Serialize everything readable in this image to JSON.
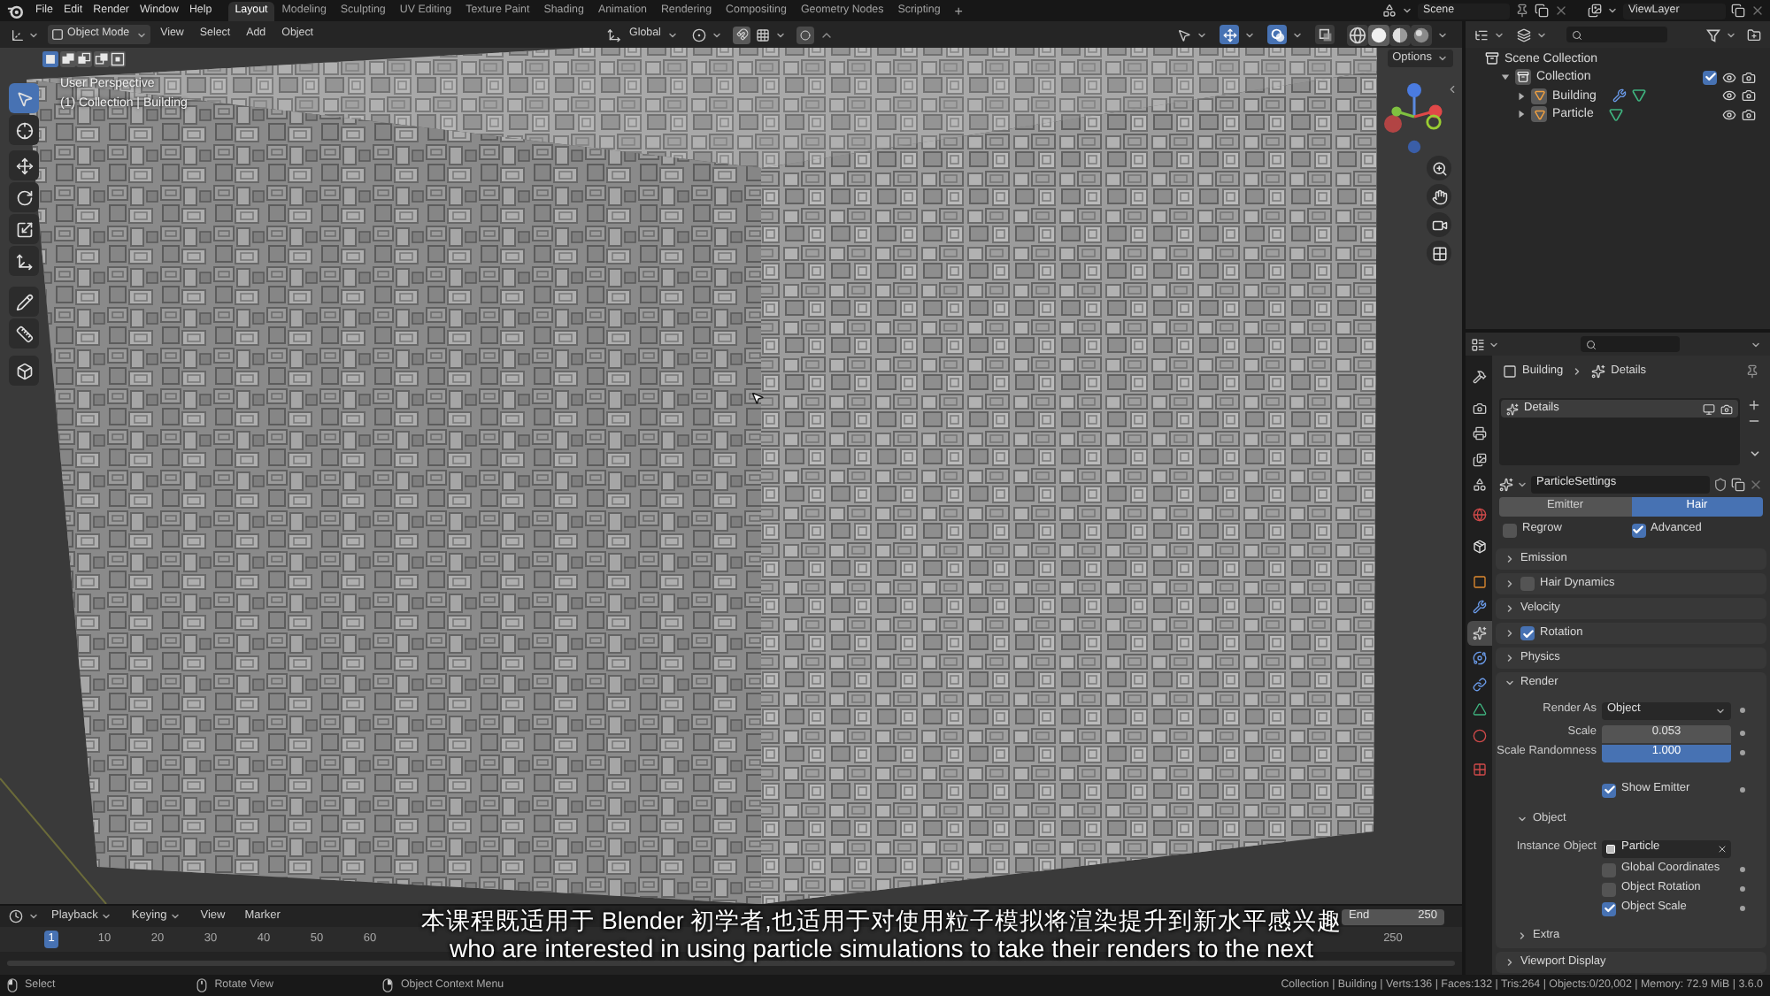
{
  "top_bar": {
    "menus": [
      "File",
      "Edit",
      "Render",
      "Window",
      "Help"
    ],
    "workspaces": [
      {
        "label": "Layout",
        "selected": true
      },
      {
        "label": "Modeling",
        "selected": false
      },
      {
        "label": "Sculpting",
        "selected": false
      },
      {
        "label": "UV Editing",
        "selected": false
      },
      {
        "label": "Texture Paint",
        "selected": false
      },
      {
        "label": "Shading",
        "selected": false
      },
      {
        "label": "Animation",
        "selected": false
      },
      {
        "label": "Rendering",
        "selected": false
      },
      {
        "label": "Compositing",
        "selected": false
      },
      {
        "label": "Geometry Nodes",
        "selected": false
      },
      {
        "label": "Scripting",
        "selected": false
      }
    ],
    "add_workspace": "+",
    "scene": "Scene",
    "view_layer": "ViewLayer"
  },
  "viewport": {
    "mode": "Object Mode",
    "menus": [
      "View",
      "Select",
      "Add",
      "Object"
    ],
    "orientation": "Global",
    "toggles": [
      {
        "kind": "gizmos",
        "on": true
      },
      {
        "kind": "overlays",
        "on": true
      },
      {
        "kind": "xray",
        "on": false
      }
    ],
    "shading": [
      {
        "kind": "wireframe",
        "selected": false
      },
      {
        "kind": "solid",
        "selected": true
      },
      {
        "kind": "material",
        "selected": false
      },
      {
        "kind": "rendered",
        "selected": false
      }
    ],
    "select_modes": [
      {
        "kind": "new",
        "selected": true
      },
      {
        "kind": "extend",
        "selected": false
      },
      {
        "kind": "subtract",
        "selected": false
      },
      {
        "kind": "invert",
        "selected": false
      },
      {
        "kind": "intersect",
        "selected": false
      }
    ],
    "options": "Options",
    "view_name": "User Perspective",
    "context": "(1) Collection | Building",
    "tools": [
      {
        "kind": "select",
        "selected": true
      },
      {
        "kind": "cursor",
        "selected": false
      },
      {
        "kind": "move",
        "selected": false
      },
      {
        "kind": "rotate",
        "selected": false
      },
      {
        "kind": "scale",
        "selected": false
      },
      {
        "kind": "transform",
        "selected": false
      },
      {
        "kind": "annotate",
        "selected": false
      },
      {
        "kind": "measure",
        "selected": false
      },
      {
        "kind": "add_cube",
        "selected": false
      }
    ]
  },
  "timeline": {
    "menus": [
      "Playback",
      "Keying",
      "View",
      "Marker"
    ],
    "end_label": "End",
    "end_value": "250",
    "frames": [
      {
        "label": "1",
        "selected": true
      },
      {
        "label": "10",
        "selected": false
      },
      {
        "label": "20",
        "selected": false
      },
      {
        "label": "30",
        "selected": false
      },
      {
        "label": "40",
        "selected": false
      },
      {
        "label": "50",
        "selected": false
      },
      {
        "label": "60",
        "selected": false
      },
      {
        "label": "250",
        "selected": false
      }
    ]
  },
  "subtitles": [
    "本课程既适用于 Blender 初学者,也适用于对使用粒子模拟将渲染提升到新水平感兴趣",
    "who are interested in using particle simulations to take their renders to the next"
  ],
  "outliner": {
    "tree": [
      {
        "label": "Scene Collection",
        "kind": "scene",
        "children": [
          {
            "label": "Collection",
            "kind": "collection",
            "expanded": true,
            "checked": true,
            "children": [
              {
                "label": "Building",
                "kind": "object",
                "expanded": false,
                "modifier": true
              },
              {
                "label": "Particle",
                "kind": "object",
                "expanded": false,
                "modifier": false
              }
            ]
          }
        ]
      }
    ]
  },
  "properties": {
    "tabs": [
      {
        "kind": "tool",
        "selected": false
      },
      {
        "kind": "render",
        "selected": false
      },
      {
        "kind": "output",
        "selected": false
      },
      {
        "kind": "view_layer",
        "selected": false
      },
      {
        "kind": "scene",
        "selected": false
      },
      {
        "kind": "world",
        "selected": false
      },
      {
        "kind": "collection",
        "selected": false
      },
      {
        "kind": "object",
        "selected": false
      },
      {
        "kind": "modifiers",
        "selected": false
      },
      {
        "kind": "particles",
        "selected": true
      },
      {
        "kind": "physics",
        "selected": false
      },
      {
        "kind": "constraints",
        "selected": false
      },
      {
        "kind": "data",
        "selected": false
      },
      {
        "kind": "material",
        "selected": false
      },
      {
        "kind": "texture",
        "selected": false
      }
    ],
    "breadcrumb": [
      "Building",
      "Details"
    ],
    "systems": [
      {
        "label": "Details",
        "selected": true
      }
    ],
    "settings": "ParticleSettings",
    "type_tabs": [
      {
        "label": "Emitter",
        "selected": false
      },
      {
        "label": "Hair",
        "selected": true
      }
    ],
    "options": [
      {
        "label": "Regrow",
        "checked": false
      },
      {
        "label": "Advanced",
        "checked": true
      }
    ],
    "panels": [
      {
        "label": "Emission",
        "kind": "plain",
        "expanded": false
      },
      {
        "label": "Hair Dynamics",
        "kind": "toggle",
        "checked": false,
        "expanded": false
      },
      {
        "label": "Velocity",
        "kind": "plain",
        "expanded": false
      },
      {
        "label": "Rotation",
        "kind": "toggle",
        "checked": true,
        "expanded": false
      },
      {
        "label": "Physics",
        "kind": "plain",
        "expanded": false
      },
      {
        "label": "Render",
        "kind": "plain",
        "expanded": true,
        "rows": [
          {
            "kind": "dropdown",
            "label": "Render As",
            "value": "Object"
          },
          {
            "kind": "number",
            "label": "Scale",
            "value": "0.053"
          },
          {
            "kind": "slider",
            "label": "Scale Randomness",
            "value": "1.000",
            "level": 1
          },
          {
            "kind": "checkbox",
            "label": "Show Emitter",
            "checked": true
          },
          {
            "kind": "subpanel",
            "label": "Object",
            "expanded": true,
            "rows": [
              {
                "kind": "object",
                "label": "Instance Object",
                "value": "Particle"
              },
              {
                "kind": "checkbox",
                "label": "Global Coordinates",
                "checked": false
              },
              {
                "kind": "checkbox",
                "label": "Object Rotation",
                "checked": false
              },
              {
                "kind": "checkbox",
                "label": "Object Scale",
                "checked": true
              }
            ]
          },
          {
            "kind": "subpanel",
            "label": "Extra",
            "expanded": false
          }
        ]
      },
      {
        "label": "Viewport Display",
        "kind": "plain",
        "expanded": false
      }
    ]
  },
  "status_bar": {
    "hints": [
      {
        "kind": "left_click",
        "label": "Select"
      },
      {
        "kind": "middle_click",
        "label": "Rotate View"
      },
      {
        "kind": "right_click",
        "label": "Object Context Menu"
      }
    ],
    "stats": "Collection | Building | Verts:136 | Faces:132 | Tris:264 | Objects:0/20,002 | Memory: 72.9 MiB | 3.6.0"
  }
}
